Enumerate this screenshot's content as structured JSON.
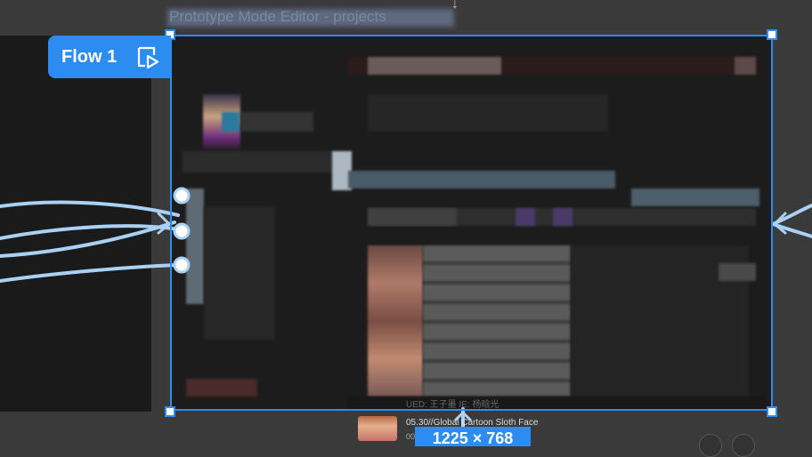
{
  "canvas": {
    "title": "Prototype Mode Editor - projects",
    "flow": {
      "label": "Flow 1",
      "play_icon": "play-flow-icon"
    },
    "selection": {
      "dimensions": "1225 × 768"
    },
    "overlay": {
      "credit": "UED: 王子墨  IE: 杨晗光",
      "card_title": "05.30//Global Cartoon Sloth Face",
      "card_subtitle": "00"
    },
    "colors": {
      "accent": "#2d8cf0",
      "connector": "#a9d1f5",
      "canvas_bg": "#3a3a3a"
    }
  }
}
